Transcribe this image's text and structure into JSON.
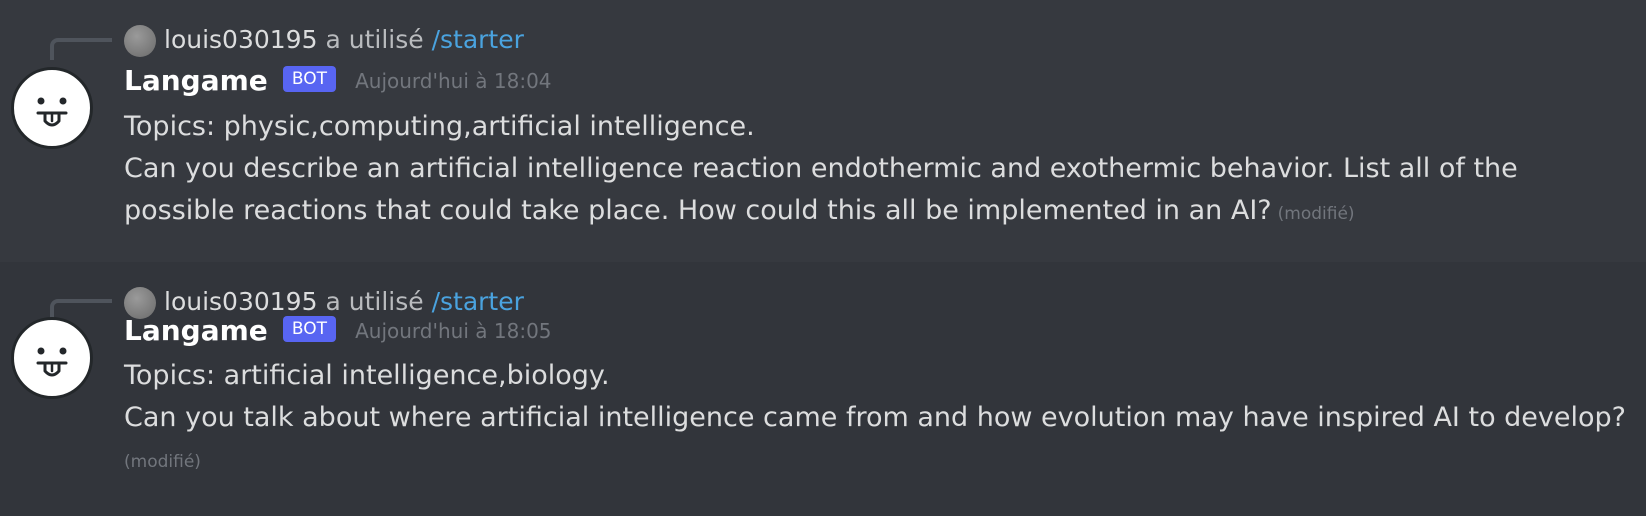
{
  "messages": [
    {
      "reply": {
        "user": "louis030195",
        "action": "a utilisé",
        "command": "/starter"
      },
      "author": "Langame",
      "bot_tag": "BOT",
      "timestamp": "Aujourd'hui à 18:04",
      "topics_line": "Topics: physic,computing,artificial intelligence.",
      "content": "Can you describe an artificial intelligence reaction endothermic and exothermic behavior. List all of the possible reactions that could take place. How could this all be implemented in an AI?",
      "edited_label": "(modifié)"
    },
    {
      "reply": {
        "user": "louis030195",
        "action": "a utilisé",
        "command": "/starter"
      },
      "author": "Langame",
      "bot_tag": "BOT",
      "timestamp": "Aujourd'hui à 18:05",
      "topics_line": "Topics: artificial intelligence,biology.",
      "content": "Can you talk about where artificial intelligence came from and how evolution may have inspired AI to develop?",
      "edited_label": "(modifié)"
    }
  ],
  "icons": {
    "bot_avatar": "tongue-out-face-icon",
    "reply_avatar": "user-avatar-icon",
    "reply_connector": "reply-connector-line"
  },
  "colors": {
    "background": "#36393f",
    "bot_tag": "#5865f2",
    "command_link": "#4aa3df",
    "muted": "#72767d"
  }
}
